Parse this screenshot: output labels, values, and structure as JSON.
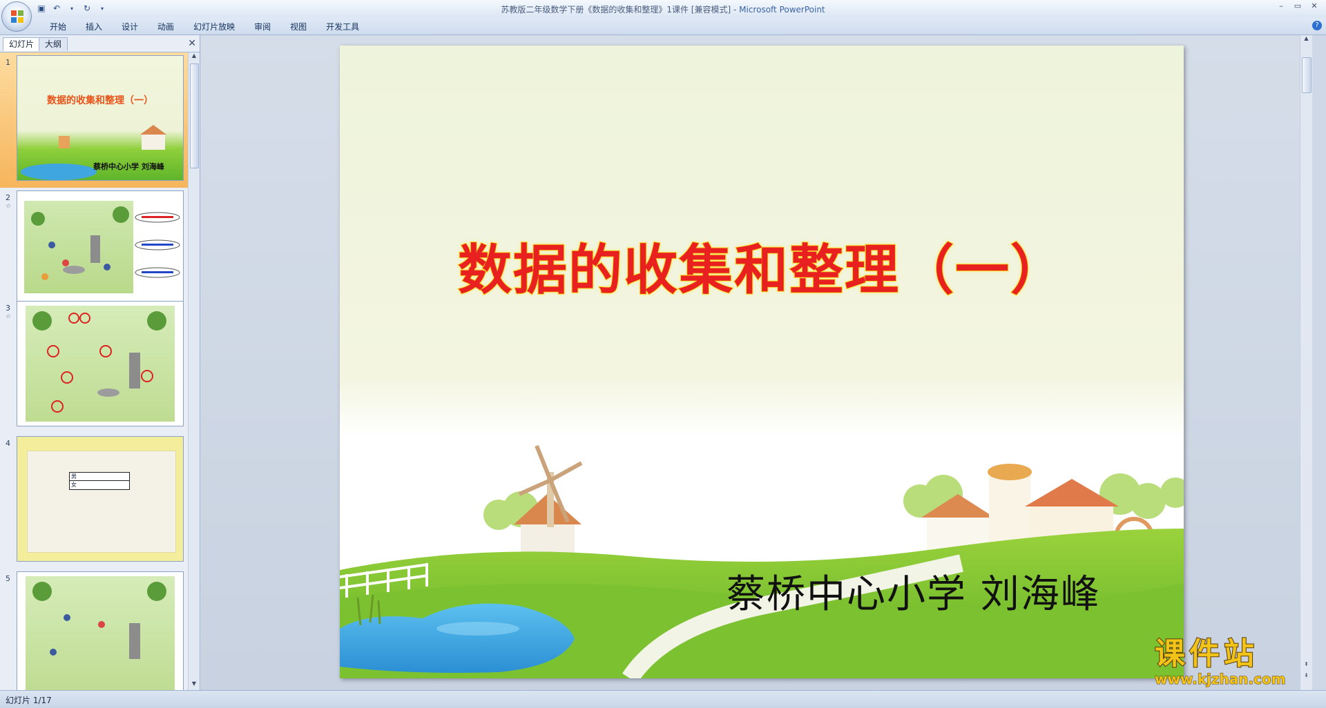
{
  "window": {
    "title_doc": "苏教版二年级数学下册《数据的收集和整理》1课件 [兼容模式]",
    "title_sep": " - ",
    "title_app": "Microsoft PowerPoint"
  },
  "ribbon": {
    "tabs": [
      "开始",
      "插入",
      "设计",
      "动画",
      "幻灯片放映",
      "审阅",
      "视图",
      "开发工具"
    ]
  },
  "panel": {
    "tab_slides": "幻灯片",
    "tab_outline": "大纲",
    "thumbnails": [
      {
        "num": "1",
        "title": "数据的收集和整理（一）",
        "author": "蔡桥中心小学  刘海峰",
        "selected": true
      },
      {
        "num": "2",
        "star": "☆"
      },
      {
        "num": "3",
        "star": "☆"
      },
      {
        "num": "4",
        "row1": "男",
        "row2": "女"
      },
      {
        "num": "5"
      }
    ]
  },
  "slide": {
    "title": "数据的收集和整理（一）",
    "author": "蔡桥中心小学  刘海峰"
  },
  "status": {
    "slide_indicator": "幻灯片 1/17"
  },
  "watermark": {
    "line1": "课件站",
    "line2": "www.kjzhan.com"
  },
  "colors": {
    "title_red": "#e82020",
    "title_outline": "#f6d311",
    "selection": "#f6b55b"
  }
}
